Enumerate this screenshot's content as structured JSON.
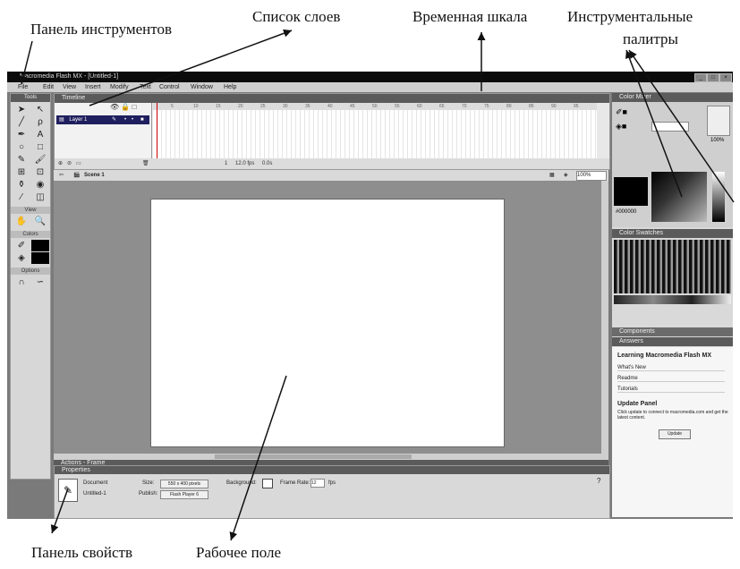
{
  "annotations": {
    "tools_panel": "Панель инструментов",
    "layer_list": "Список слоев",
    "timeline": "Временная шкала",
    "palettes_line1": "Инструментальные",
    "palettes_line2": "палитры",
    "properties_panel": "Панель свойств",
    "work_area": "Рабочее поле"
  },
  "window": {
    "title": "Macromedia Flash MX - [Untitled-1]",
    "menu": [
      "File",
      "Edit",
      "View",
      "Insert",
      "Modify",
      "Text",
      "Control",
      "Window",
      "Help"
    ]
  },
  "tools": {
    "title": "Tools",
    "sections": [
      "View",
      "Colors",
      "Options"
    ]
  },
  "timeline": {
    "title": "Timeline",
    "layer_name": "Layer 1",
    "fps": "12.0 fps",
    "time": "0.0s",
    "frame": "1",
    "ruler": [
      "5",
      "10",
      "15",
      "20",
      "25",
      "30",
      "35",
      "40",
      "45",
      "50",
      "55",
      "60",
      "65",
      "70",
      "75",
      "80",
      "85",
      "90",
      "95"
    ]
  },
  "editbar": {
    "scene": "Scene 1",
    "zoom": "100%"
  },
  "bottom": {
    "actions_title": "Actions - Frame",
    "properties_title": "Properties",
    "doc_label": "Document",
    "doc_name": "Untitled-1",
    "size_label": "Size:",
    "size_value": "550 x 400 pixels",
    "bg_label": "Background:",
    "fr_label": "Frame Rate:",
    "fr_value": "12",
    "fps_unit": "fps",
    "publish_label": "Publish:",
    "publish_value": "Flash Player 6"
  },
  "right": {
    "mixer_title": "Color Mixer",
    "hex": "#000000",
    "alpha": "100%",
    "swatches_title": "Color Swatches",
    "components_title": "Components",
    "answers_title": "Answers",
    "howdo_title": "Learning Macromedia Flash MX",
    "items": [
      "What's New",
      "Readme",
      "Tutorials"
    ],
    "update_title": "Update Panel",
    "update_text": "Click update to connect to macromedia.com and get the latest content.",
    "update_button": "Update"
  },
  "colors": {
    "bg": "#ffffff",
    "screen": "#7a7a7a",
    "panel_header": "#5b5b5b"
  }
}
